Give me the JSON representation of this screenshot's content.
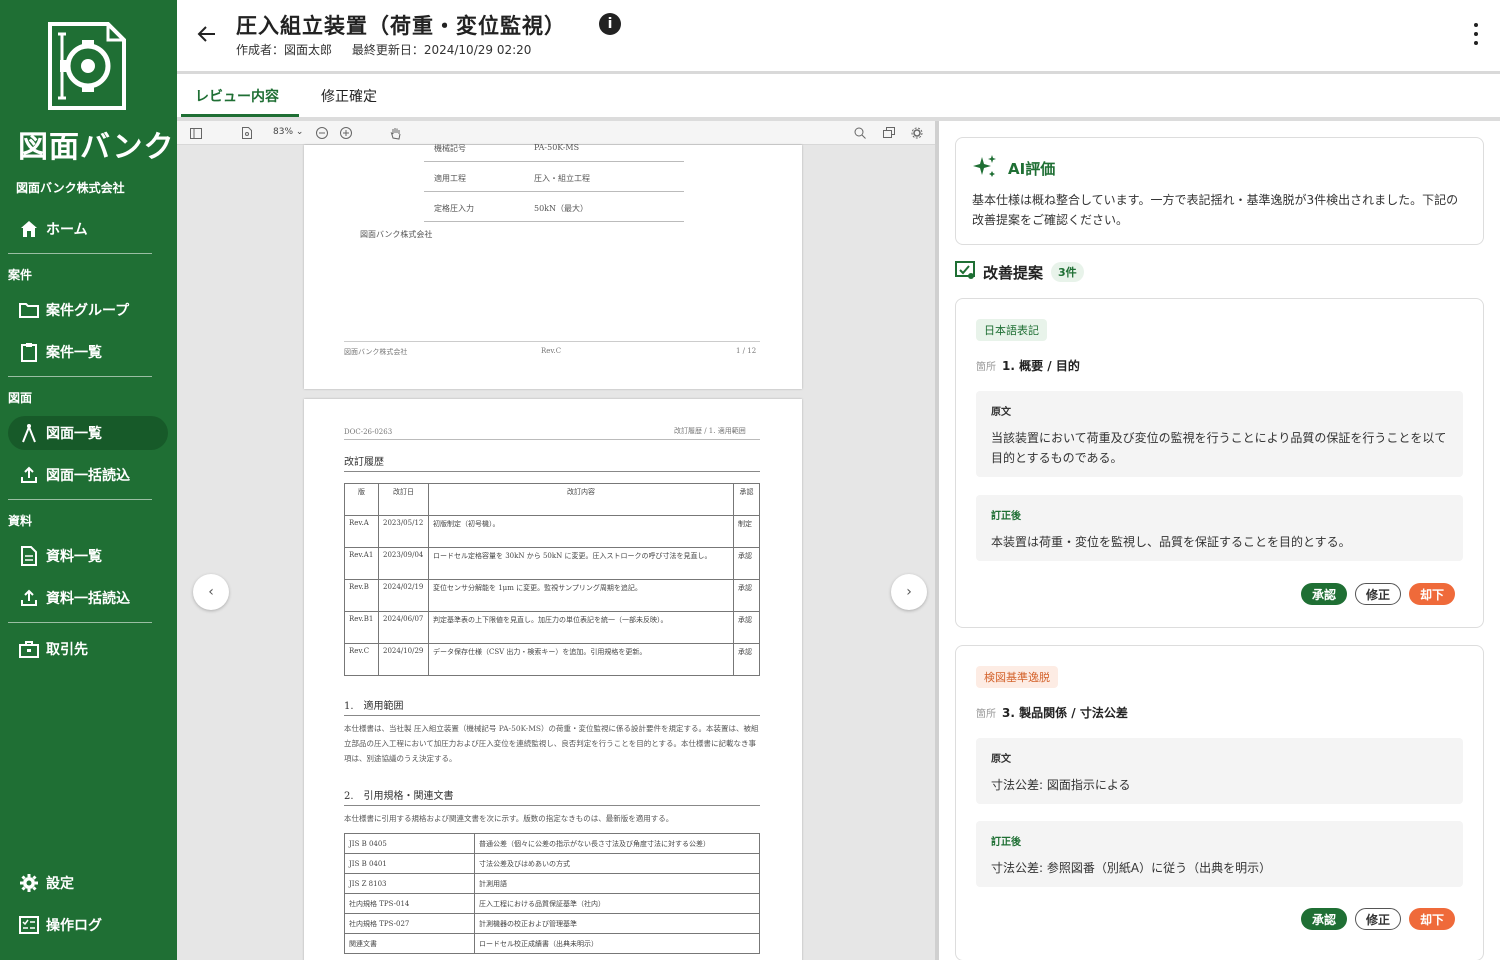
{
  "sidebar": {
    "brand": "図面バンク",
    "company": "図面バンク株式会社",
    "home": "ホーム",
    "sections": {
      "cases": "案件",
      "drawings": "図面",
      "materials": "資料"
    },
    "items": {
      "case_group": "案件グループ",
      "case_list": "案件一覧",
      "drawing_list": "図面一覧",
      "drawing_bulk": "図面一括読込",
      "material_list": "資料一覧",
      "material_bulk": "資料一括読込",
      "clients": "取引先",
      "settings": "設定",
      "logs": "操作ログ"
    }
  },
  "header": {
    "title": "圧入組立装置（荷重・変位監視）",
    "author": "作成者：図面太郎",
    "updated": "最終更新日：2024/10/29 02:20",
    "info": "i"
  },
  "tabs": {
    "review": "レビュー内容",
    "confirm": "修正確定"
  },
  "viewer": {
    "zoom": "83%",
    "page1": {
      "rows": [
        {
          "k": "機械記号",
          "v": "PA-50K-MS"
        },
        {
          "k": "適用工程",
          "v": "圧入・組立工程"
        },
        {
          "k": "定格圧入力",
          "v": "50kN（最大）"
        }
      ],
      "company": "図面バンク株式会社",
      "footer_left": "図面バンク株式会社",
      "footer_mid": "Rev.C",
      "footer_right": "1 / 12"
    },
    "page2": {
      "doc_no": "DOC-26-0263",
      "header_right": "改訂履歴 / 1. 適用範囲",
      "rev_title": "改訂履歴",
      "rev_headers": [
        "版",
        "改訂日",
        "改訂内容",
        "承認"
      ],
      "revisions": [
        {
          "ver": "Rev.A",
          "date": "2023/05/12",
          "desc": "初版制定（初号機）。",
          "appr": "制定"
        },
        {
          "ver": "Rev.A1",
          "date": "2023/09/04",
          "desc": "ロードセル定格容量を 30kN から 50kN に変更。圧入ストロークの呼び寸法を見直し。",
          "appr": "承認"
        },
        {
          "ver": "Rev.B",
          "date": "2024/02/19",
          "desc": "変位センサ分解能を 1μm に変更。監視サンプリング周期を追記。",
          "appr": "承認"
        },
        {
          "ver": "Rev.B1",
          "date": "2024/06/07",
          "desc": "判定基準表の上下限値を見直し。加圧力の単位表記を統一（一部未反映）。",
          "appr": "承認"
        },
        {
          "ver": "Rev.C",
          "date": "2024/10/29",
          "desc": "データ保存仕様（CSV 出力・検索キー）を追加。引用規格を更新。",
          "appr": "承認"
        }
      ],
      "sec1_title": "1.　適用範囲",
      "sec1_body": "本仕様書は、当社製 圧入組立装置（機械記号 PA-50K-MS）の荷重・変位監視に係る設計要件を規定する。本装置は、被組立部品の圧入工程において加圧力および圧入変位を連続監視し、良否判定を行うことを目的とする。本仕様書に記載なき事項は、別途協議のうえ決定する。",
      "sec2_title": "2.　引用規格・関連文書",
      "sec2_body": "本仕様書に引用する規格および関連文書を次に示す。版数の指定なきものは、最新版を適用する。",
      "standards": [
        {
          "code": "JIS B 0405",
          "name": "普通公差（個々に公差の指示がない長さ寸法及び角度寸法に対する公差）"
        },
        {
          "code": "JIS B 0401",
          "name": "寸法公差及びはめあいの方式"
        },
        {
          "code": "JIS Z 8103",
          "name": "計測用語"
        },
        {
          "code": "社内規格 TPS-014",
          "name": "圧入工程における品質保証基準（社内）"
        },
        {
          "code": "社内規格 TPS-027",
          "name": "計測機器の校正および管理基準"
        },
        {
          "code": "関連文書",
          "name": "ロードセル校正成績書（出典未明示）"
        }
      ]
    }
  },
  "ai": {
    "title": "AI評価",
    "body": "基本仕様は概ね整合しています。一方で表記揺れ・基準逸脱が3件検出されました。下記の改善提案をご確認ください。"
  },
  "suggestions": {
    "title": "改善提案",
    "count": "3件",
    "loc_label": "箇所",
    "orig_label": "原文",
    "fix_label": "訂正後",
    "approve": "承認",
    "edit": "修正",
    "reject": "却下",
    "items": [
      {
        "category": "日本語表記",
        "location": "1. 概要 / 目的",
        "original": "当該装置において荷重及び変位の監視を行うことにより品質の保証を行うことを以て目的とするものである。",
        "corrected": "本装置は荷重・変位を監視し、品質を保証することを目的とする。"
      },
      {
        "category": "検図基準逸脱",
        "location": "3. 製品関係 / 寸法公差",
        "original": "寸法公差: 図面指示による",
        "corrected": "寸法公差: 参照図番（別紙A）に従う（出典を明示）"
      }
    ]
  },
  "colors": {
    "brand": "#1f6f34",
    "reject": "#ef6a3a",
    "category_orange": "#d4632c"
  }
}
